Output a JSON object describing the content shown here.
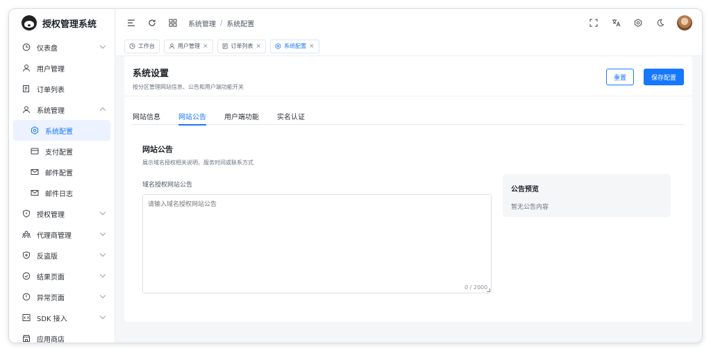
{
  "app": {
    "title": "授权管理系统"
  },
  "sidebar": {
    "items": [
      {
        "label": "仪表盘",
        "icon": "clock-icon",
        "chevron": "down"
      },
      {
        "label": "用户管理",
        "icon": "user-icon"
      },
      {
        "label": "订单列表",
        "icon": "list-icon"
      },
      {
        "label": "系统管理",
        "icon": "user-icon",
        "chevron": "up"
      },
      {
        "label": "系统配置",
        "icon": "gear-icon",
        "sub": true,
        "active": true
      },
      {
        "label": "支付配置",
        "icon": "card-icon",
        "sub": true
      },
      {
        "label": "邮件配置",
        "icon": "mail-icon",
        "sub": true
      },
      {
        "label": "邮件日志",
        "icon": "mail-icon",
        "sub": true
      },
      {
        "label": "授权管理",
        "icon": "shield-icon",
        "chevron": "down"
      },
      {
        "label": "代理商管理",
        "icon": "group-icon",
        "chevron": "down"
      },
      {
        "label": "反盗版",
        "icon": "shield-plus-icon",
        "chevron": "down"
      },
      {
        "label": "结果页面",
        "icon": "check-circle-icon",
        "chevron": "down"
      },
      {
        "label": "异常页面",
        "icon": "alert-circle-icon",
        "chevron": "down"
      },
      {
        "label": "SDK 接入",
        "icon": "code-icon",
        "chevron": "down"
      },
      {
        "label": "应用商店",
        "icon": "store-icon"
      }
    ]
  },
  "breadcrumb": {
    "parent": "系统管理",
    "current": "系统配置",
    "separator": "/"
  },
  "tabs": [
    {
      "label": "工作台",
      "icon": "clock-icon",
      "closable": false
    },
    {
      "label": "用户管理",
      "icon": "user-icon",
      "closable": true
    },
    {
      "label": "订单列表",
      "icon": "list-icon",
      "closable": true
    },
    {
      "label": "系统配置",
      "icon": "gear-icon",
      "closable": true,
      "active": true
    }
  ],
  "page": {
    "title": "系统设置",
    "description": "按分区管理网站信息、公告和用户端功能开关",
    "reset_label": "重置",
    "save_label": "保存配置"
  },
  "subtabs": [
    "网站信息",
    "网站公告",
    "用户端功能",
    "实名认证"
  ],
  "active_subtab": "网站公告",
  "section": {
    "title": "网站公告",
    "description": "展示域名授权相关说明、服务时间或联系方式",
    "field_label": "域名授权网站公告",
    "placeholder": "请输入域名授权网站公告",
    "counter": "0 / 2000"
  },
  "preview": {
    "title": "公告预览",
    "empty_text": "暂无公告内容"
  },
  "colors": {
    "accent": "#1677ff",
    "background": "#f5f6f8"
  }
}
